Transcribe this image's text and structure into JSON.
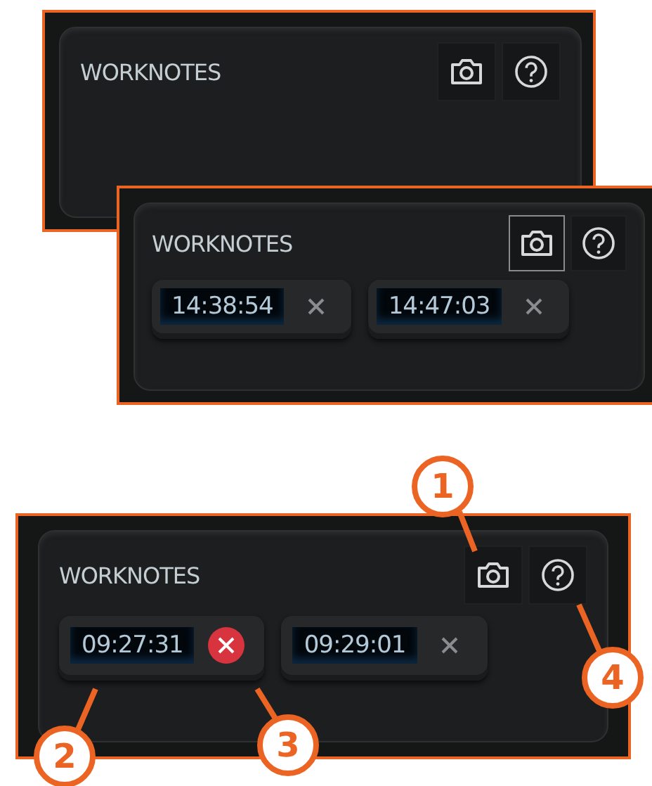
{
  "panels": [
    {
      "title": "WORKNOTES",
      "tools": [
        {
          "kind": "camera",
          "highlighted": false
        },
        {
          "kind": "help",
          "highlighted": false
        }
      ]
    },
    {
      "title": "WORKNOTES",
      "tools": [
        {
          "kind": "camera",
          "highlighted": true
        },
        {
          "kind": "help",
          "highlighted": false
        }
      ],
      "notes": [
        {
          "time": "14:38:54",
          "close_hovered": false
        },
        {
          "time": "14:47:03",
          "close_hovered": false
        }
      ]
    },
    {
      "title": "WORKNOTES",
      "tools": [
        {
          "kind": "camera",
          "highlighted": false
        },
        {
          "kind": "help",
          "highlighted": false
        }
      ],
      "notes": [
        {
          "time": "09:27:31",
          "close_hovered": true
        },
        {
          "time": "09:29:01",
          "close_hovered": false
        }
      ]
    }
  ],
  "callouts": [
    {
      "number": "1"
    },
    {
      "number": "2"
    },
    {
      "number": "3"
    },
    {
      "number": "4"
    }
  ]
}
